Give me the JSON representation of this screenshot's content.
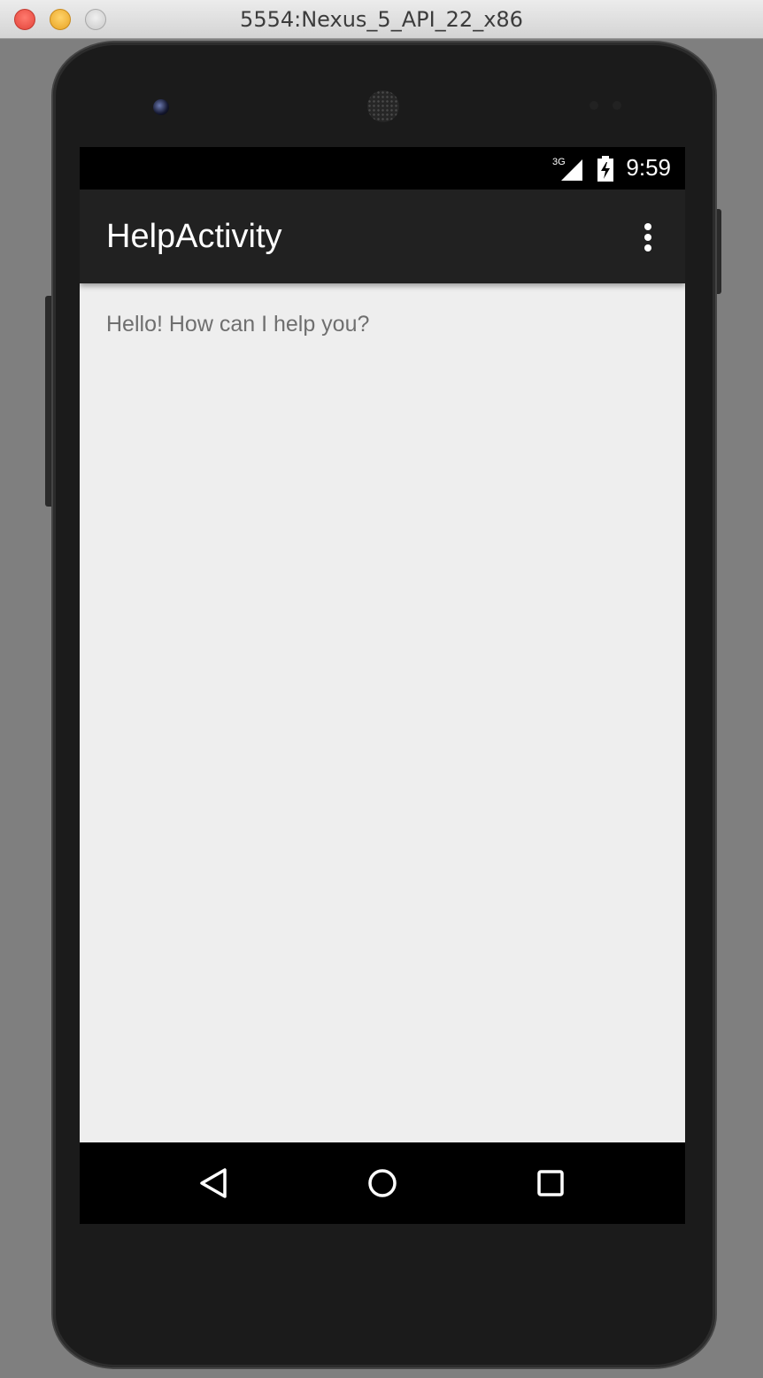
{
  "window": {
    "title": "5554:Nexus_5_API_22_x86"
  },
  "status_bar": {
    "network_label": "3G",
    "time": "9:59",
    "icons": [
      "signal-3g-icon",
      "battery-charging-icon"
    ]
  },
  "app_bar": {
    "title": "HelpActivity",
    "overflow_icon": "overflow-menu-icon"
  },
  "content": {
    "message": "Hello! How can I help you?"
  },
  "nav_bar": {
    "icons": [
      "back-icon",
      "home-icon",
      "recents-icon"
    ]
  },
  "colors": {
    "app_bar": "#212121",
    "content_background": "#eeeeee",
    "content_text": "#6f6f6f",
    "system_bars": "#000000"
  }
}
